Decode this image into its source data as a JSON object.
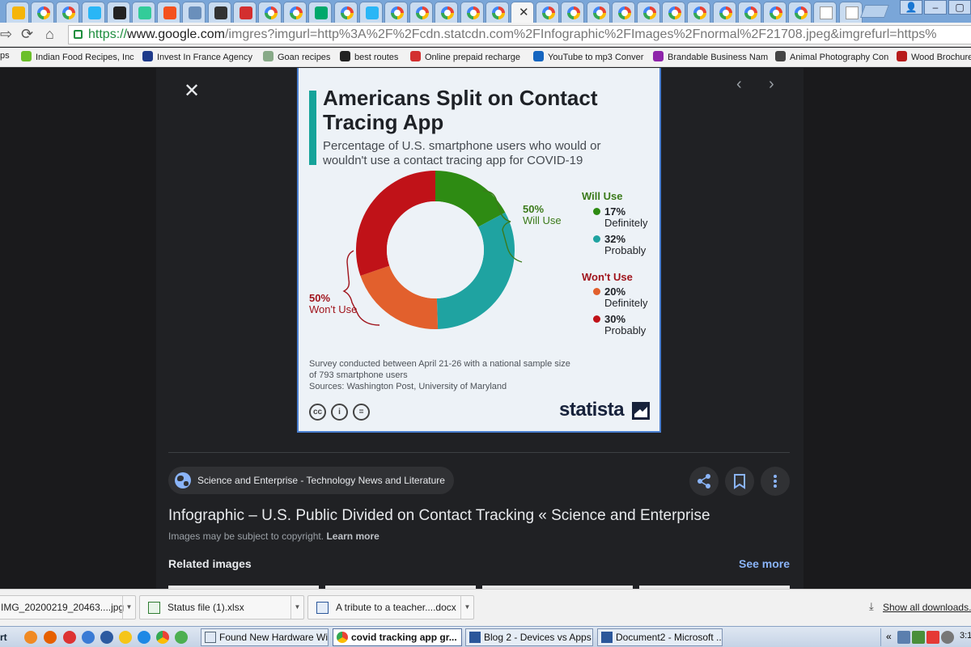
{
  "browser": {
    "tabs_count": 34,
    "url": {
      "scheme": "https://",
      "host": "www.google.com",
      "path": "/imgres?imgurl=http%3A%2F%2Fcdn.statcdn.com%2FInfographic%2FImages%2Fnormal%2F21708.jpeg&imgrefurl=https%"
    },
    "bookmarks": [
      {
        "label": "ps",
        "icon": "folder-icon"
      },
      {
        "label": "Indian Food Recipes, Inc",
        "icon": "food-icon"
      },
      {
        "label": "Invest In France Agency",
        "icon": "france-icon"
      },
      {
        "label": "Goan recipes",
        "icon": "recipe-icon"
      },
      {
        "label": "best routes",
        "icon": "route-icon"
      },
      {
        "label": "Online prepaid recharge",
        "icon": "recharge-icon"
      },
      {
        "label": "YouTube to mp3 Conver",
        "icon": "mp3-icon"
      },
      {
        "label": "Brandable Business Nam",
        "icon": "brand-icon"
      },
      {
        "label": "Animal Photography Con",
        "icon": "animal-icon"
      },
      {
        "label": "Wood Brochure",
        "icon": "wood-icon"
      }
    ]
  },
  "viewer": {
    "close_glyph": "✕",
    "prev_glyph": "‹",
    "next_glyph": "›",
    "infographic": {
      "title": "Americans Split on Contact Tracing App",
      "subtitle": "Percentage of U.S. smartphone users who would or wouldn't use a contact tracing app for COVID-19",
      "note": "Survey conducted between April 21-26 with a national sample size of 793 smartphone users",
      "sources": "Sources: Washington Post, University of Maryland",
      "brand": "statista",
      "license_icons": [
        "cc",
        "by",
        "nd"
      ],
      "license_labels": [
        "cc",
        "i",
        "="
      ]
    },
    "source_label": "Science and Enterprise - Technology News and Literature",
    "page_title": "Infographic – U.S. Public Divided on Contact Tracking « Science and Enterprise",
    "copyright_text": "Images may be subject to copyright.",
    "learn_more": "Learn more",
    "related_label": "Related images",
    "see_more": "See more"
  },
  "chart_data": {
    "type": "pie",
    "title": "Americans Split on Contact Tracing App",
    "subtitle": "Percentage of U.S. smartphone users who would or wouldn't use a contact tracing app for COVID-19",
    "unit": "%",
    "groups": [
      {
        "name": "Will Use",
        "total_label": "50%",
        "total_text": "Will Use",
        "color": "#3b7a1a",
        "slices": [
          {
            "label": "Definitely",
            "value": 17,
            "value_label": "17%",
            "color": "#2e8b13"
          },
          {
            "label": "Probably",
            "value": 32,
            "value_label": "32%",
            "color": "#1fa3a1"
          }
        ]
      },
      {
        "name": "Won't Use",
        "total_label": "50%",
        "total_text": "Won't Use",
        "color": "#a0141c",
        "slices": [
          {
            "label": "Definitely",
            "value": 20,
            "value_label": "20%",
            "color": "#e2602d"
          },
          {
            "label": "Probably",
            "value": 30,
            "value_label": "30%",
            "color": "#c01218"
          }
        ]
      }
    ],
    "legend_position": "right"
  },
  "downloads": {
    "items": [
      {
        "name": "IMG_20200219_20463....jpg",
        "type": "image"
      },
      {
        "name": "Status file (1).xlsx",
        "type": "excel"
      },
      {
        "name": "A tribute to a teacher....docx",
        "type": "word"
      }
    ],
    "show_all": "Show all downloads..."
  },
  "taskbar": {
    "start_label": "rt",
    "tasks": [
      {
        "label": "Found New Hardware Wi...",
        "active": false
      },
      {
        "label": "covid tracking app gr...",
        "active": true
      },
      {
        "label": "Blog 2 - Devices vs Apps ...",
        "active": false
      },
      {
        "label": "Document2 - Microsoft ...",
        "active": false
      }
    ],
    "tray_chevron": "«",
    "clock": "3:1"
  }
}
